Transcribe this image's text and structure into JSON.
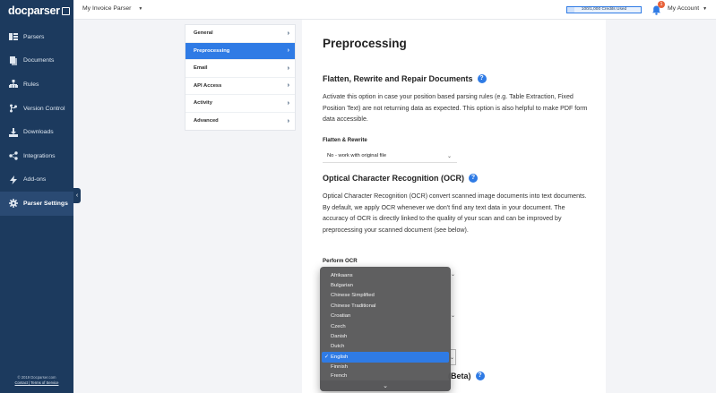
{
  "sidebar": {
    "logo": "docparser",
    "items": [
      {
        "label": "Parsers",
        "icon": "parsers-icon"
      },
      {
        "label": "Documents",
        "icon": "documents-icon"
      },
      {
        "label": "Rules",
        "icon": "rules-icon"
      },
      {
        "label": "Version Control",
        "icon": "version-control-icon"
      },
      {
        "label": "Downloads",
        "icon": "downloads-icon"
      },
      {
        "label": "Integrations",
        "icon": "integrations-icon"
      },
      {
        "label": "Add-ons",
        "icon": "add-ons-icon"
      },
      {
        "label": "Parser Settings",
        "icon": "gear-icon",
        "active": true
      }
    ],
    "footer_copyright": "© 2019 Docparser.com",
    "footer_links": "Contact | Terms of Service"
  },
  "topbar": {
    "parser_name": "My Invoice Parser",
    "credits_text": "100/1,000 Credits Used",
    "credits_used_fraction": 0.1,
    "notification_count": "1",
    "account_label": "My Account"
  },
  "settings_menu": {
    "items": [
      {
        "label": "General"
      },
      {
        "label": "Preprocessing",
        "active": true
      },
      {
        "label": "Email"
      },
      {
        "label": "API Access"
      },
      {
        "label": "Activity"
      },
      {
        "label": "Advanced"
      }
    ]
  },
  "main": {
    "title": "Preprocessing",
    "flatten": {
      "title": "Flatten, Rewrite and Repair Documents",
      "description": "Activate this option in case your position based parsing rules (e.g. Table Extraction, Fixed Position Text) are not returning data as expected. This option is also helpful to make PDF form data accessible.",
      "field_label": "Flatten & Rewrite",
      "field_value": "No - work with original file"
    },
    "ocr": {
      "title": "Optical Character Recognition (OCR)",
      "description": "Optical Character Recognition (OCR) convert scanned image documents into text documents. By default, we apply OCR whenever we don't find any text data in your document. The accuracy of OCR is directly linked to the quality of your scan and can be improved by preprocessing your scanned document (see below).",
      "field_label": "Perform OCR"
    },
    "beta_title_suffix": "(Beta)"
  },
  "dropdown": {
    "options": [
      "Afrikaans",
      "Bulgarian",
      "Chinese Simplified",
      "Chinese Traditional",
      "Croatian",
      "Czech",
      "Danish",
      "Dutch",
      "English",
      "Finnish",
      "French"
    ],
    "selected": "English"
  },
  "colors": {
    "sidebar_bg": "#1c3a5e",
    "accent": "#2f7be5",
    "badge": "#e8623a"
  }
}
